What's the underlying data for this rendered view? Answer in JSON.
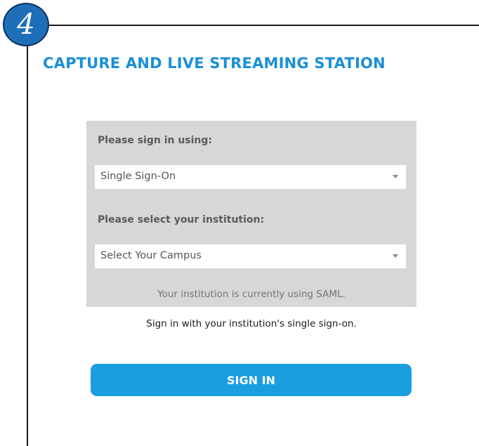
{
  "step": {
    "number": "4"
  },
  "app": {
    "title": "CAPTURE AND LIVE STREAMING STATION"
  },
  "signin_form": {
    "method_label": "Please sign in using:",
    "method_value": "Single Sign-On",
    "institution_label": "Please select your institution:",
    "institution_value": "Select Your Campus",
    "saml_note": "Your institution is currently using SAML.",
    "sso_note": "Sign in with your institution's single sign-on.",
    "signin_label": "SIGN IN"
  },
  "colors": {
    "accent": "#1b9ee0",
    "title": "#1b8fd8",
    "badge": "#1f6fb8",
    "panel": "#d7d7d7"
  },
  "icons": {
    "dropdown": "caret-down-icon"
  }
}
